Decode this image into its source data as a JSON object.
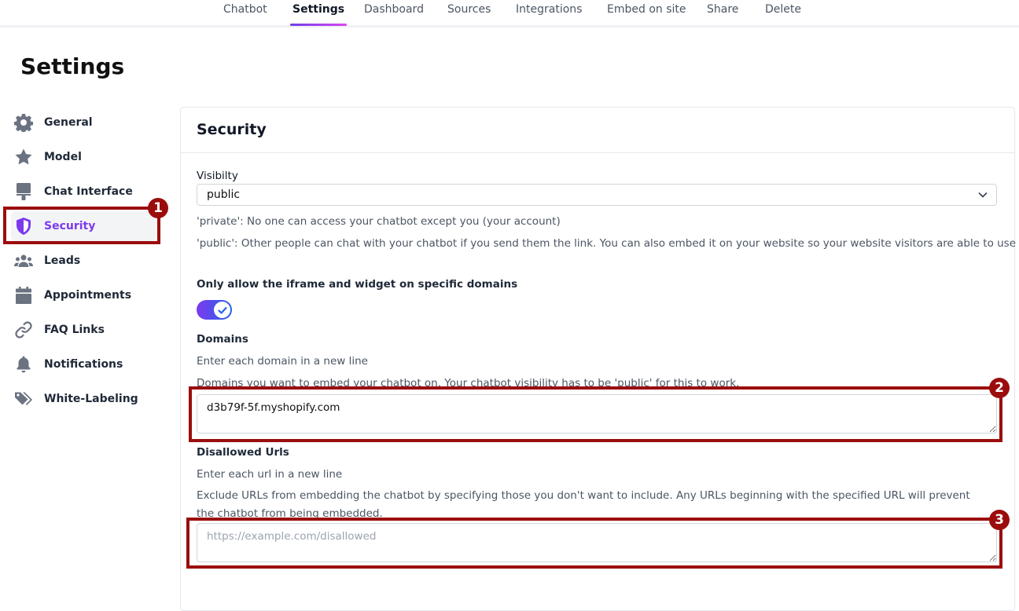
{
  "nav": {
    "tabs": [
      {
        "label": "Chatbot"
      },
      {
        "label": "Settings",
        "active": true
      },
      {
        "label": "Dashboard"
      },
      {
        "label": "Sources"
      },
      {
        "label": "Integrations"
      },
      {
        "label": "Embed on site"
      },
      {
        "label": "Share"
      },
      {
        "label": "Delete"
      }
    ]
  },
  "page": {
    "title": "Settings"
  },
  "sidebar": {
    "items": [
      {
        "label": "General",
        "icon": "gear-icon"
      },
      {
        "label": "Model",
        "icon": "star-icon"
      },
      {
        "label": "Chat Interface",
        "icon": "paint-brush-icon"
      },
      {
        "label": "Security",
        "icon": "shield-icon",
        "active": true
      },
      {
        "label": "Leads",
        "icon": "users-icon"
      },
      {
        "label": "Appointments",
        "icon": "calendar-icon"
      },
      {
        "label": "FAQ Links",
        "icon": "link-icon"
      },
      {
        "label": "Notifications",
        "icon": "bell-icon"
      },
      {
        "label": "White-Labeling",
        "icon": "tags-icon"
      }
    ]
  },
  "security": {
    "title": "Security",
    "visibility": {
      "label": "Visibilty",
      "value": "public",
      "help_private": "'private': No one can access your chatbot except you (your account)",
      "help_public": "'public': Other people can chat with your chatbot if you send them the link. You can also embed it on your website so your website visitors are able to use it."
    },
    "domain_restrict": {
      "label": "Only allow the iframe and widget on specific domains",
      "enabled": true
    },
    "domains": {
      "label": "Domains",
      "help1": "Enter each domain in a new line",
      "help2": "Domains you want to embed your chatbot on. Your chatbot visibility has to be 'public' for this to work.",
      "value": "d3b79f-5f.myshopify.com"
    },
    "disallowed": {
      "label": "Disallowed Urls",
      "help1": "Enter each url in a new line",
      "help2": "Exclude URLs from embedding the chatbot by specifying those you don't want to include. Any URLs beginning with the specified URL will prevent the chatbot from being embedded.",
      "placeholder": "https://example.com/disallowed",
      "value": ""
    }
  },
  "annotations": [
    {
      "number": "1",
      "target": "Security sidebar item"
    },
    {
      "number": "2",
      "target": "Domains field"
    },
    {
      "number": "3",
      "target": "Disallowed Urls field"
    }
  ],
  "colors": {
    "accent": "#7c3aed",
    "annotation": "#9b0d0d"
  }
}
